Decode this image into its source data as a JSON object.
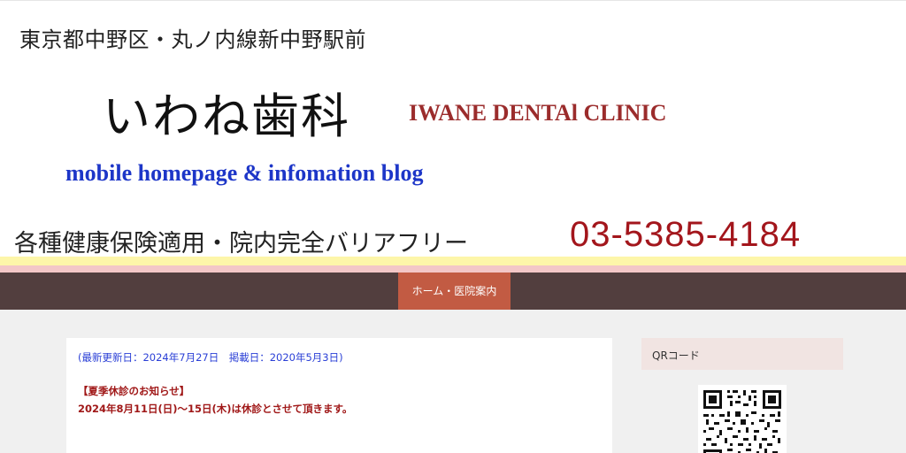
{
  "header": {
    "location": "東京都中野区・丸ノ内線新中野駅前",
    "clinic_name": "いわね歯科",
    "clinic_name_en": "IWANE DENTAl CLINIC",
    "subtitle": "mobile homepage & infomation blog",
    "insurance": "各種健康保険適用・院内完全バリアフリー",
    "phone": "03-5385-4184"
  },
  "nav": {
    "items": [
      {
        "label": "ホーム・医院案内",
        "active": true
      }
    ],
    "active_color": "#c25b43",
    "bar_color": "#523e3e"
  },
  "main": {
    "updated": "(最新更新日：2024年7月27日　掲載日：2020年5月3日)",
    "notice_title": "【夏季休診のお知らせ】",
    "notice_body": "2024年8月11日(日)〜15日(木)は休診とさせて頂きます。"
  },
  "sidebar": {
    "qr_title": "QRコード",
    "qr_icon": "qr-code-icon"
  },
  "colors": {
    "stripe_yellow": "#fdf6a9",
    "stripe_pink": "#f3c7c7",
    "notice_red": "#a01818",
    "link_blue": "#2a3fd6"
  }
}
